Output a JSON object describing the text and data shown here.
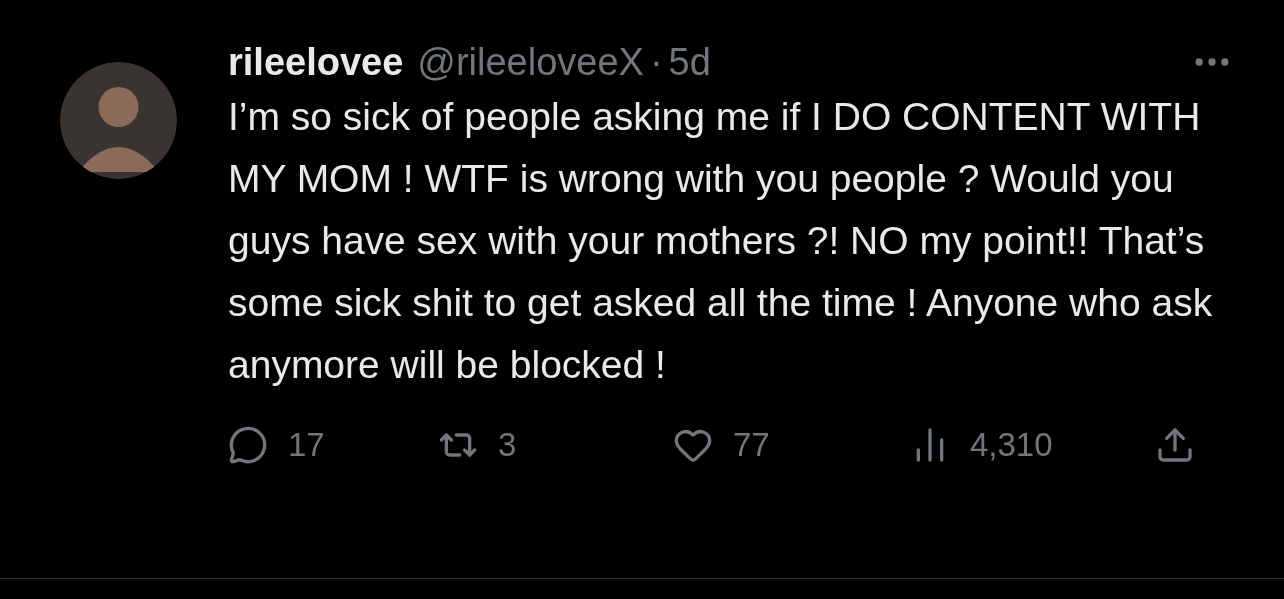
{
  "tweet": {
    "display_name": "rileelovee",
    "handle": "@rileeloveeX",
    "separator": "·",
    "time": "5d",
    "text": "I’m so sick of people asking me if I DO CONTENT WITH MY MOM ! WTF is wrong with you people ? Would you guys have sex with your mothers ?! NO my point!! That’s some sick shit to get asked all the time ! Anyone who ask anymore will be blocked !",
    "actions": [
      {
        "kind": "reply",
        "count": "17"
      },
      {
        "kind": "repost",
        "count": "3"
      },
      {
        "kind": "like",
        "count": "77"
      },
      {
        "kind": "views",
        "count": "4,310"
      },
      {
        "kind": "share"
      }
    ]
  }
}
